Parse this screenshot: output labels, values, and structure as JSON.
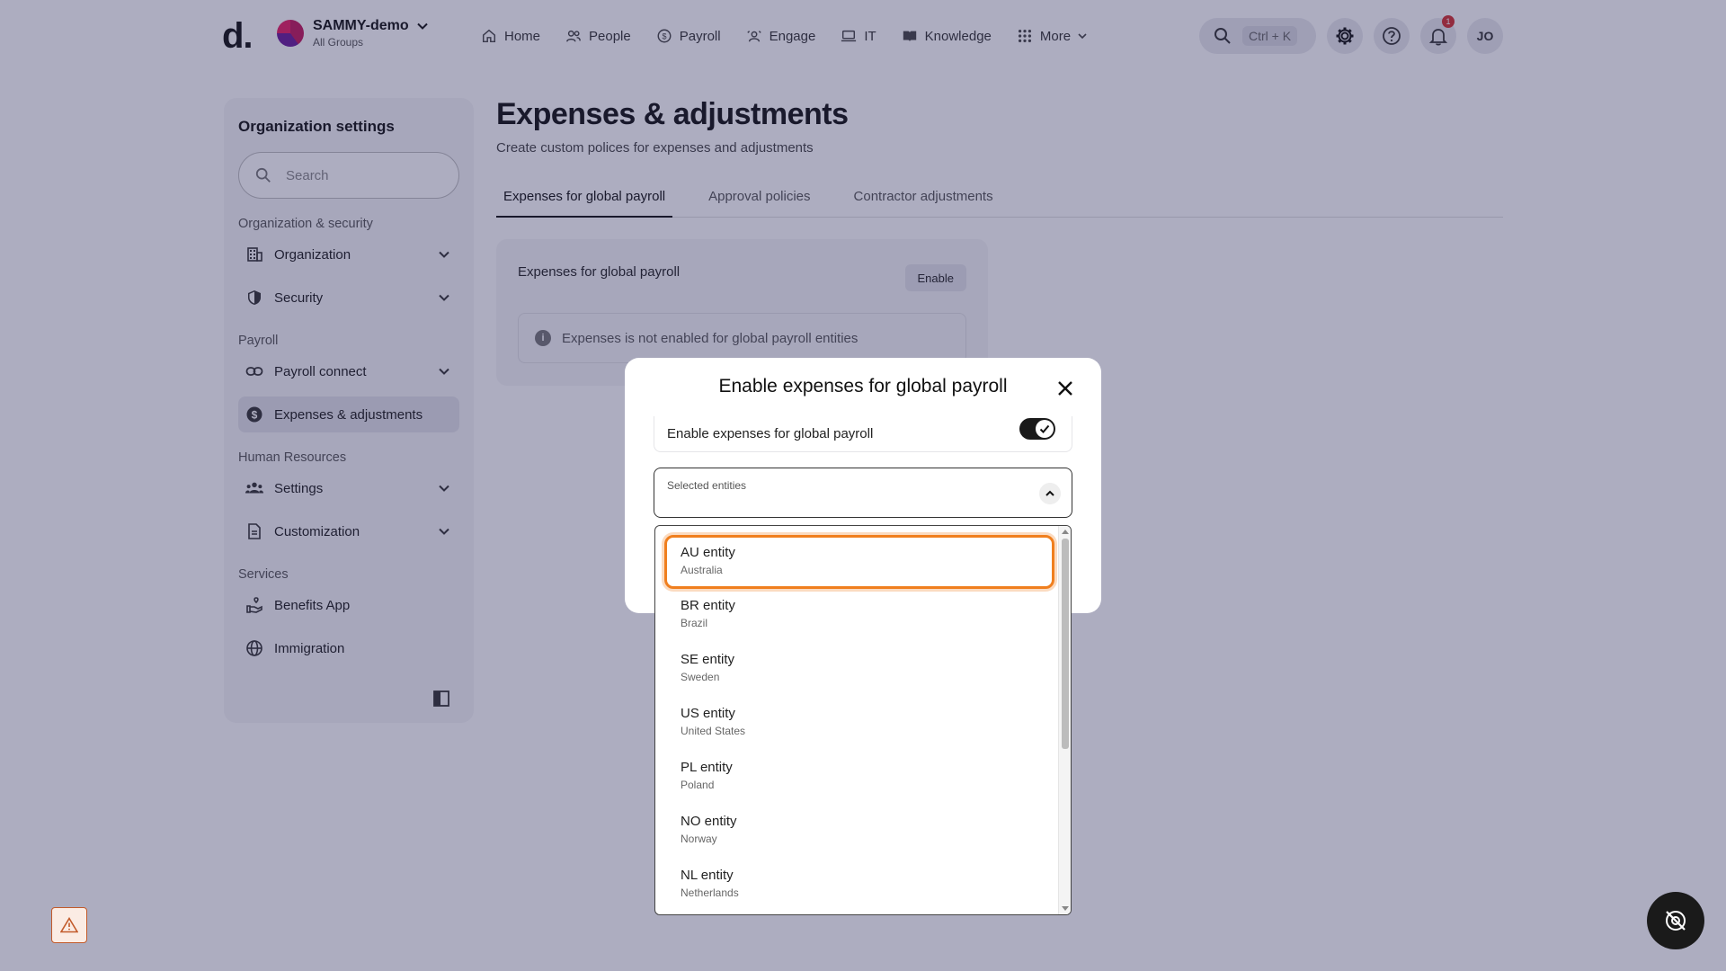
{
  "brand": {
    "logo": "d."
  },
  "org": {
    "name": "SAMMY-demo",
    "subtitle": "All Groups"
  },
  "nav": {
    "items": [
      {
        "label": "Home",
        "icon": "home-icon"
      },
      {
        "label": "People",
        "icon": "people-icon"
      },
      {
        "label": "Payroll",
        "icon": "payroll-icon"
      },
      {
        "label": "Engage",
        "icon": "engage-icon"
      },
      {
        "label": "IT",
        "icon": "laptop-icon"
      },
      {
        "label": "Knowledge",
        "icon": "book-icon"
      },
      {
        "label": "More",
        "icon": "grid-icon"
      }
    ],
    "search_shortcut": "Ctrl + K",
    "notifications_count": "1",
    "user_initials": "JO"
  },
  "sidebar": {
    "title": "Organization settings",
    "search_placeholder": "Search",
    "sections": [
      {
        "label": "Organization & security"
      },
      {
        "label": "Payroll"
      },
      {
        "label": "Human Resources"
      },
      {
        "label": "Services"
      }
    ],
    "items": [
      {
        "label": "Organization",
        "icon": "building-icon"
      },
      {
        "label": "Security",
        "icon": "shield-icon"
      },
      {
        "label": "Payroll connect",
        "icon": "link-icon"
      },
      {
        "label": "Expenses & adjustments",
        "icon": "dollar-icon"
      },
      {
        "label": "Settings",
        "icon": "team-icon"
      },
      {
        "label": "Customization",
        "icon": "document-icon"
      },
      {
        "label": "Benefits App",
        "icon": "benefits-icon"
      },
      {
        "label": "Immigration",
        "icon": "globe-icon"
      }
    ]
  },
  "main": {
    "title": "Expenses & adjustments",
    "subtitle": "Create custom polices for expenses and adjustments",
    "tabs": [
      {
        "label": "Expenses for global payroll",
        "active": true
      },
      {
        "label": "Approval policies",
        "active": false
      },
      {
        "label": "Contractor adjustments",
        "active": false
      }
    ],
    "card": {
      "title": "Expenses for global payroll",
      "button": "Enable",
      "note": "Expenses is not enabled for global payroll entities"
    }
  },
  "modal": {
    "title": "Enable expenses for global payroll",
    "toggle_label": "Enable expenses for global payroll",
    "toggle_on": true,
    "select_label": "Selected entities"
  },
  "dropdown": {
    "options": [
      {
        "name": "AU entity",
        "country": "Australia",
        "focused": true
      },
      {
        "name": "BR entity",
        "country": "Brazil"
      },
      {
        "name": "SE entity",
        "country": "Sweden"
      },
      {
        "name": "US entity",
        "country": "United States"
      },
      {
        "name": "PL entity",
        "country": "Poland"
      },
      {
        "name": "NO entity",
        "country": "Norway"
      },
      {
        "name": "NL entity",
        "country": "Netherlands"
      }
    ]
  },
  "colors": {
    "focus_ring": "#f07f1e",
    "overlay": "#28285a",
    "badge": "#d32f2f"
  }
}
